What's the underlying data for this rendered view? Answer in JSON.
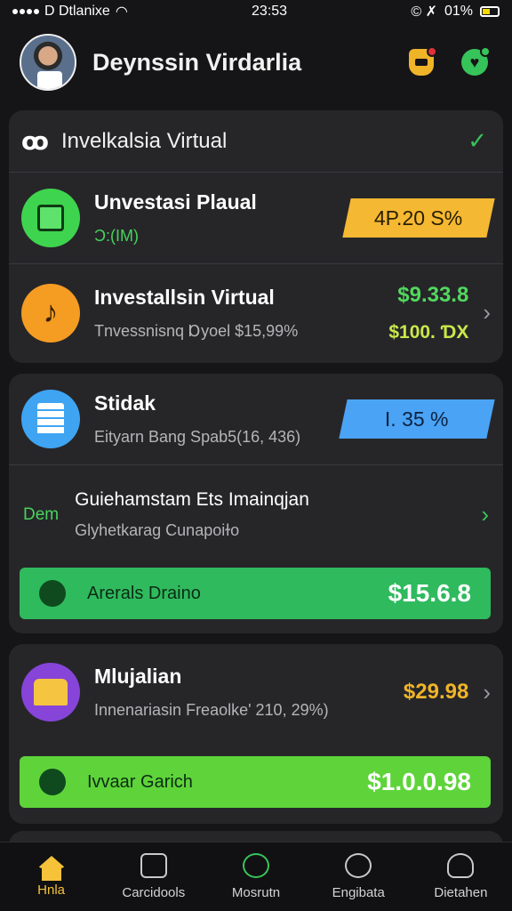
{
  "status_bar": {
    "carrier": "D Dtlanixe",
    "time": "23:53",
    "battery": "01%",
    "extra_icons": "© ✗"
  },
  "header": {
    "title": "Deynssin Virdarlia",
    "shield_badge_color": "#f0b429",
    "notif_dot_colors": [
      "#e0303a",
      "#36c35a"
    ]
  },
  "card1": {
    "title": "Invelkalsia Virtual",
    "rows": [
      {
        "title": "Unvestasi Plaual",
        "subtitle": "Ɔ:(IM)",
        "tag": "4P.20 S%",
        "icon": "document-grid-icon"
      },
      {
        "title": "Investallsin Virtual",
        "subtitle": "Tnvessnisnq Ɒyoel $15,99%",
        "value": "$9.33.8",
        "value_sub": "$100. ƊX",
        "icon": "music-note-icon"
      }
    ]
  },
  "card2": {
    "row": {
      "title": "Stidak",
      "subtitle": "Eityarn Bang Spab5(16, 436)",
      "tag": "I. 35 %",
      "icon": "document-icon"
    },
    "guide": {
      "tag": "Dem",
      "title": "Guiehamstam Ets Imainqjan",
      "subtitle": "Glyhetkarag Cunapoiɫo"
    },
    "action": {
      "label": "Arerals Draino",
      "value": "$15.6.8"
    }
  },
  "card3": {
    "row": {
      "title": "Mlujalian",
      "subtitle": "Innenariasin Freaolke' 210, 29%)",
      "value": "$29.98",
      "icon": "temple-icon"
    },
    "action": {
      "label": "Ivvaar Garich",
      "value": "$1.0.0.98"
    }
  },
  "nav": {
    "items": [
      {
        "label": "Hnla",
        "active": true
      },
      {
        "label": "Carcidools",
        "active": false
      },
      {
        "label": "Mosrutn",
        "active": false
      },
      {
        "label": "Engibata",
        "active": false
      },
      {
        "label": "Dietahen",
        "active": false
      }
    ]
  }
}
